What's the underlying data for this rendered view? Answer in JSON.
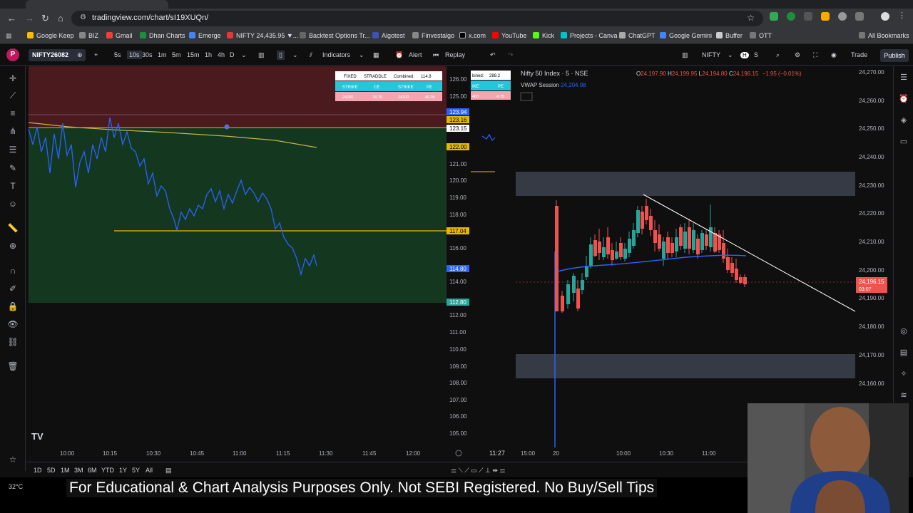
{
  "browser": {
    "url": "tradingview.com/chart/sI19XUQn/",
    "bookmarks": [
      "Google Keep",
      "BIZ",
      "Gmail",
      "Dhan Charts",
      "Emerge",
      "NIFTY 24,435.95 ▼...",
      "Backtest Options Tr...",
      "Algotest",
      "Finvestalgo",
      "x.com",
      "YouTube",
      "Kick",
      "Projects - Canva",
      "ChatGPT",
      "Google Gemini",
      "Buffer",
      "OTT"
    ],
    "all_bookmarks": "All Bookmarks"
  },
  "toolbar": {
    "symbol": "NIFTY26082",
    "intervals": [
      "5s",
      "10s",
      "30s",
      "1m",
      "5m",
      "15m",
      "1h",
      "4h",
      "D"
    ],
    "indicators": "Indicators",
    "alert": "Alert",
    "replay": "Replay",
    "right_symbol": "NIFTY",
    "trade": "Trade",
    "publish": "Publish",
    "avatar": "P",
    "avatar_badge": "11"
  },
  "left_chart": {
    "table": {
      "row1": [
        "FIXED",
        "STRADDLE",
        "Combined:",
        "114.8"
      ],
      "row2": [
        "STRIKE",
        "CE",
        "STRIKE",
        "PE"
      ],
      "row3": [
        "24200",
        "74.75",
        "24100",
        "40.05"
      ]
    },
    "price_axis": [
      "126.00",
      "125.00",
      "123.94",
      "123.16",
      "123.15",
      "122.00",
      "121.00",
      "120.00",
      "119.00",
      "118.00",
      "117.04",
      "116.00",
      "114.80",
      "114.00",
      "112.80",
      "112.00",
      "111.00",
      "110.00",
      "109.00",
      "108.00",
      "107.00",
      "106.00",
      "105.00"
    ],
    "time_axis": [
      "10:00",
      "10:15",
      "10:30",
      "10:45",
      "11:00",
      "11:15",
      "11:30",
      "11:45",
      "12:00"
    ],
    "logo": "TV"
  },
  "mid_chart": {
    "header": [
      "bined:",
      "289.2"
    ],
    "cells": [
      "IKE",
      "PE",
      "400",
      "4.75"
    ],
    "time_label": "11:27"
  },
  "right_chart": {
    "title": "Nifty 50 Index · 5 · NSE",
    "ohlc": {
      "o": "24,197.90",
      "h": "24,199.95",
      "l": "24,194.80",
      "c": "24,196.15",
      "chg": "−1.95 (−0.01%)"
    },
    "vwap_label": "VWAP Session",
    "vwap_value": "24,204.98",
    "price_axis": [
      "24,270.00",
      "24,260.00",
      "24,250.00",
      "24,240.00",
      "24,230.00",
      "24,220.00",
      "24,210.00",
      "24,200.00",
      "24,190.00",
      "24,180.00",
      "24,170.00",
      "24,160.00"
    ],
    "last_price": "24,196.15",
    "countdown": "03:07",
    "time_axis": [
      "15:00",
      "20",
      "10:00",
      "10:30",
      "11:00"
    ]
  },
  "bottom": {
    "ranges": [
      "1D",
      "5D",
      "1M",
      "3M",
      "6M",
      "YTD",
      "1Y",
      "5Y",
      "All"
    ]
  },
  "caption": "For Educational & Chart Analysis Purposes Only. Not SEBI Registered. No Buy/Sell Tips",
  "temperature": "32°C",
  "colors": {
    "bull": "#26a69a",
    "bear": "#ef5350",
    "line": "#2962ff",
    "yellow": "#e6b800",
    "zone_red": "#4a1a1f",
    "zone_green": "#14381f"
  }
}
